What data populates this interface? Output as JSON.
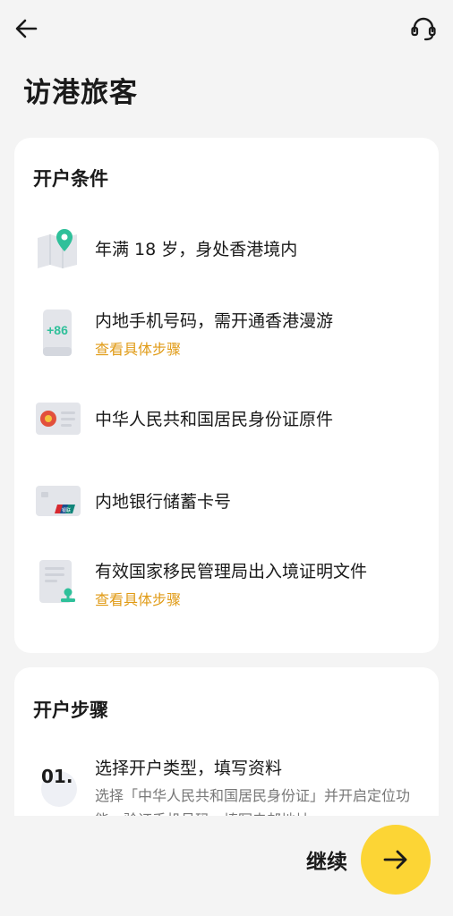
{
  "header": {
    "back_icon": "arrow-left-icon",
    "support_icon": "headset-icon"
  },
  "page": {
    "title": "访港旅客"
  },
  "conditions": {
    "title": "开户条件",
    "items": [
      {
        "icon": "map-pin-icon",
        "text": "年满 18 岁，身处香港境内",
        "link": ""
      },
      {
        "icon": "phone-icon",
        "icon_text": "+86",
        "text": "内地手机号码，需开通香港漫游",
        "link": "查看具体步骤"
      },
      {
        "icon": "id-card-icon",
        "text": "中华人民共和国居民身份证原件",
        "link": ""
      },
      {
        "icon": "bank-card-icon",
        "icon_text": "银联",
        "text": "内地银行储蓄卡号",
        "link": ""
      },
      {
        "icon": "document-stamp-icon",
        "text": "有效国家移民管理局出入境证明文件",
        "link": "查看具体步骤"
      }
    ]
  },
  "steps": {
    "title": "开户步骤",
    "items": [
      {
        "number": "01.",
        "title": "选择开户类型，填写资料",
        "desc": "选择「中华人民共和国居民身份证」并开启定位功能，验证手机号码，填写电邮地址"
      }
    ]
  },
  "footer": {
    "continue_label": "继续",
    "continue_icon": "arrow-right-icon"
  },
  "colors": {
    "accent": "#fcd535",
    "link": "#e09a14",
    "green": "#2fc09a"
  }
}
